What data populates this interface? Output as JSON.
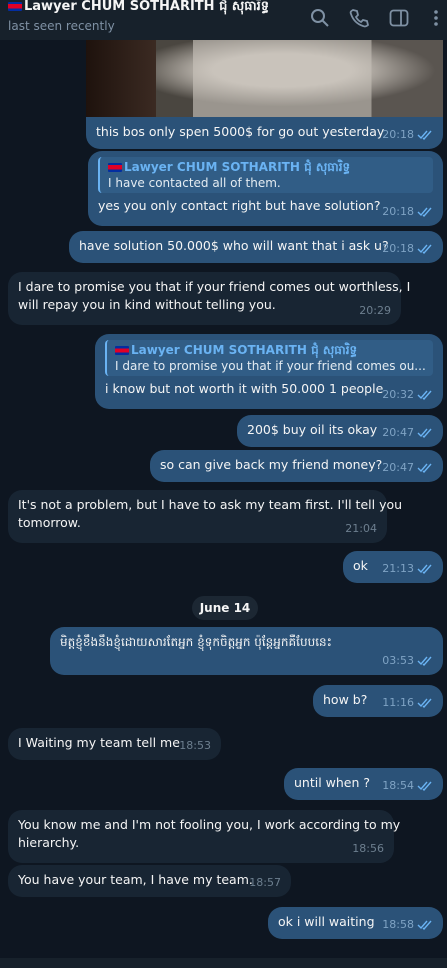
{
  "header": {
    "contact_name": "Lawyer  CHUM SOTHARITH ជុំ សុធារិទ្ធ",
    "status": "last seen recently"
  },
  "messages": [
    {
      "text": "this bos only spen 5000$ for go out yesterday",
      "time": "20:18",
      "dir": "out"
    },
    {
      "reply_name": "Lawyer  CHUM SOTHARITH ជុំ សុធារិទ្ធ",
      "reply_text": "I have contacted all of them.",
      "text": "yes you only contact right but have solution?",
      "time": "20:18",
      "dir": "out"
    },
    {
      "text": "have solution 50.000$ who will want that i ask u?",
      "time": "20:18",
      "dir": "out"
    },
    {
      "text": "I dare to promise you that if your friend comes out worthless, I",
      "text2": "will repay you in kind without telling you.",
      "time": "20:29",
      "dir": "in"
    },
    {
      "reply_name": "Lawyer  CHUM SOTHARITH ជុំ សុធារិទ្ធ",
      "reply_text": "I dare to promise you that if your friend comes ou...",
      "text": "i know but not worth it with 50.000 1 people",
      "time": "20:32",
      "dir": "out"
    },
    {
      "text": "200$ buy oil its okay",
      "time": "20:47",
      "dir": "out"
    },
    {
      "text": "so can give back my friend money?",
      "time": "20:47",
      "dir": "out"
    },
    {
      "text": "It's not a problem, but I have to ask my team first. I'll tell you",
      "text2": "tomorrow.",
      "time": "21:04",
      "dir": "in"
    },
    {
      "text": "ok",
      "time": "21:13",
      "dir": "out"
    },
    {
      "text": "មិត្តខ្ញុំខឹងនឹងខ្ញុំដោយសារតែអ្នក ខ្ញុំទុកចិត្តអ្នក ប៉ុន្តែអ្នកគឺបែបនេះ",
      "time": "03:53",
      "dir": "out"
    },
    {
      "text": "how b?",
      "time": "11:16",
      "dir": "out"
    },
    {
      "text": "I Waiting my team tell me",
      "time": "18:53",
      "dir": "in"
    },
    {
      "text": "until when ?",
      "time": "18:54",
      "dir": "out"
    },
    {
      "text": "You know me and I'm not fooling you, I work according to my",
      "text2": "hierarchy.",
      "time": "18:56",
      "dir": "in"
    },
    {
      "text": "You have your team, I have my team.",
      "time": "18:57",
      "dir": "in"
    },
    {
      "text": "ok i will waiting",
      "time": "18:58",
      "dir": "out"
    }
  ],
  "date_divider": "June 14",
  "colors": {
    "background": "#0e1621",
    "outgoing": "#2b5278",
    "incoming": "#182533",
    "accent": "#6ab3f3"
  }
}
